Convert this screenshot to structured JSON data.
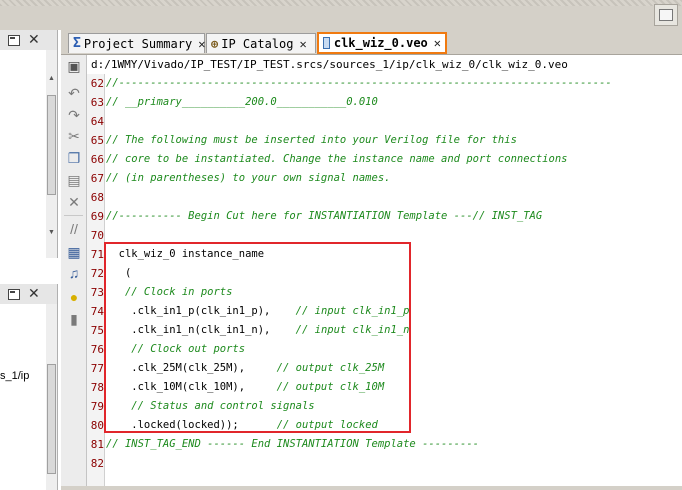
{
  "tabs": [
    {
      "label": "Project Summary",
      "icon": "sigma-icon",
      "active": false
    },
    {
      "label": "IP Catalog",
      "icon": "ip-catalog-icon",
      "active": false
    },
    {
      "label": "clk_wiz_0.veo",
      "icon": "verilog-file-icon",
      "active": true
    }
  ],
  "editor": {
    "file_path": "d:/1WMY/Vivado/IP_TEST/IP_TEST.srcs/sources_1/ip/clk_wiz_0/clk_wiz_0.veo",
    "lines": [
      {
        "no": "62",
        "text": "//------------------------------------------------------------------------------",
        "comment": true
      },
      {
        "no": "63",
        "text": "// __primary__________200.0___________0.010",
        "comment": true
      },
      {
        "no": "64",
        "text": "",
        "comment": false
      },
      {
        "no": "65",
        "text": "// The following must be inserted into your Verilog file for this",
        "comment": true
      },
      {
        "no": "66",
        "text": "// core to be instantiated. Change the instance name and port connections",
        "comment": true
      },
      {
        "no": "67",
        "text": "// (in parentheses) to your own signal names.",
        "comment": true
      },
      {
        "no": "68",
        "text": "",
        "comment": false
      },
      {
        "no": "69",
        "text": "//---------- Begin Cut here for INSTANTIATION Template ---// INST_TAG",
        "comment": true
      },
      {
        "no": "70",
        "text": "",
        "comment": false
      },
      {
        "no": "71",
        "text": "  clk_wiz_0 instance_name",
        "comment": false
      },
      {
        "no": "72",
        "text": "   (",
        "comment": false
      },
      {
        "no": "73",
        "text": "   // Clock in ports",
        "comment": true
      },
      {
        "no": "74",
        "text": "    .clk_in1_p(clk_in1_p),",
        "comment": false,
        "trailing_comment": "    // input clk_in1_p"
      },
      {
        "no": "75",
        "text": "    .clk_in1_n(clk_in1_n),",
        "comment": false,
        "trailing_comment": "    // input clk_in1_n"
      },
      {
        "no": "76",
        "text": "    // Clock out ports",
        "comment": true
      },
      {
        "no": "77",
        "text": "    .clk_25M(clk_25M),",
        "comment": false,
        "trailing_comment": "     // output clk_25M"
      },
      {
        "no": "78",
        "text": "    .clk_10M(clk_10M),",
        "comment": false,
        "trailing_comment": "     // output clk_10M"
      },
      {
        "no": "79",
        "text": "    // Status and control signals",
        "comment": true
      },
      {
        "no": "80",
        "text": "    .locked(locked));",
        "comment": false,
        "trailing_comment": "      // output locked"
      },
      {
        "no": "81",
        "text": "// INST_TAG_END ------ End INSTANTIATION Template ---------",
        "comment": true
      },
      {
        "no": "82",
        "text": "",
        "comment": false
      }
    ]
  },
  "left_panel": {
    "path_fragment": "s_1/ip"
  },
  "colors": {
    "active_tab_border": "#f07a10",
    "highlight_box": "#e1262b",
    "comment": "#1d8a1d",
    "line_number": "#8b0000"
  }
}
